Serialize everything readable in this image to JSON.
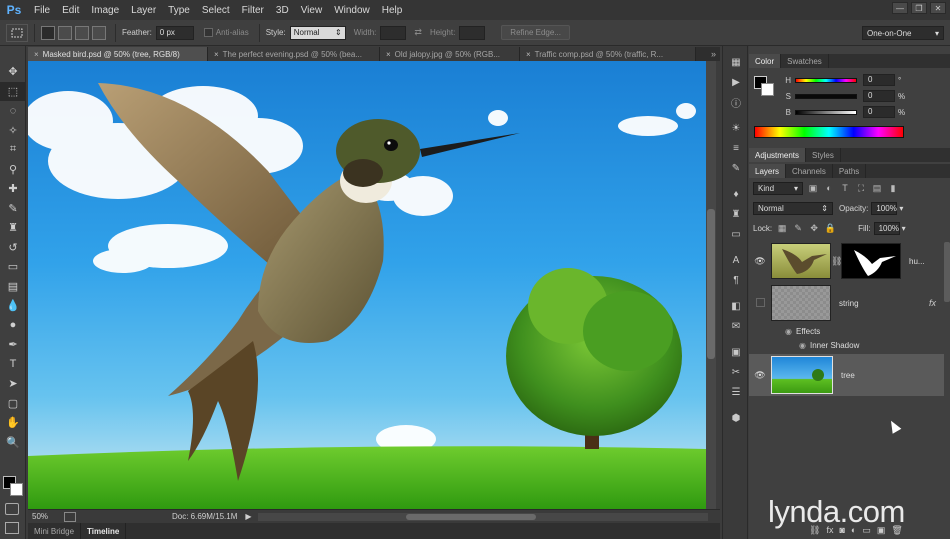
{
  "app": {
    "logo": "Ps"
  },
  "menu": [
    "File",
    "Edit",
    "Image",
    "Layer",
    "Type",
    "Select",
    "Filter",
    "3D",
    "View",
    "Window",
    "Help"
  ],
  "window_controls": [
    "—",
    "❐",
    "✕"
  ],
  "options": {
    "feather_label": "Feather:",
    "feather_value": "0 px",
    "antialias_label": "Anti-alias",
    "style_label": "Style:",
    "style_value": "Normal",
    "width_label": "Width:",
    "height_label": "Height:",
    "refine_edge": "Refine Edge...",
    "workspace": "One-on-One"
  },
  "tabs": [
    {
      "label": "Masked bird.psd @ 50% (tree, RGB/8)",
      "active": true
    },
    {
      "label": "The perfect evening.psd @ 50% (bea...",
      "active": false
    },
    {
      "label": "Old jalopy.jpg @ 50% (RGB...",
      "active": false
    },
    {
      "label": "Traffic comp.psd @ 50% (traffic, R...",
      "active": false
    }
  ],
  "status": {
    "zoom": "50%",
    "doc": "Doc: 6.69M/15.1M"
  },
  "bottom_tabs": {
    "mini_bridge": "Mini Bridge",
    "timeline": "Timeline"
  },
  "color_panel": {
    "tabs": [
      "Color",
      "Swatches"
    ],
    "channels": [
      {
        "letter": "H",
        "value": "0",
        "unit": "°"
      },
      {
        "letter": "S",
        "value": "0",
        "unit": "%"
      },
      {
        "letter": "B",
        "value": "0",
        "unit": "%"
      }
    ]
  },
  "adjust_panel": {
    "tabs": [
      "Adjustments",
      "Styles"
    ]
  },
  "layers_panel": {
    "tabs": [
      "Layers",
      "Channels",
      "Paths"
    ],
    "kind": "Kind",
    "blend": "Normal",
    "opacity_label": "Opacity:",
    "opacity_value": "100%",
    "lock_label": "Lock:",
    "fill_label": "Fill:",
    "fill_value": "100%",
    "layers": [
      {
        "name": "hu...",
        "visible": true
      },
      {
        "name": "string",
        "visible": false,
        "fx": "fx",
        "effects_label": "Effects",
        "effect": "Inner Shadow"
      },
      {
        "name": "tree",
        "visible": true,
        "selected": true
      }
    ]
  },
  "watermark": "lynda.com",
  "colors": {
    "accent_blue": "#5fb3ff",
    "panel_bg": "#404040",
    "selected_layer": "#5a5a5a"
  }
}
